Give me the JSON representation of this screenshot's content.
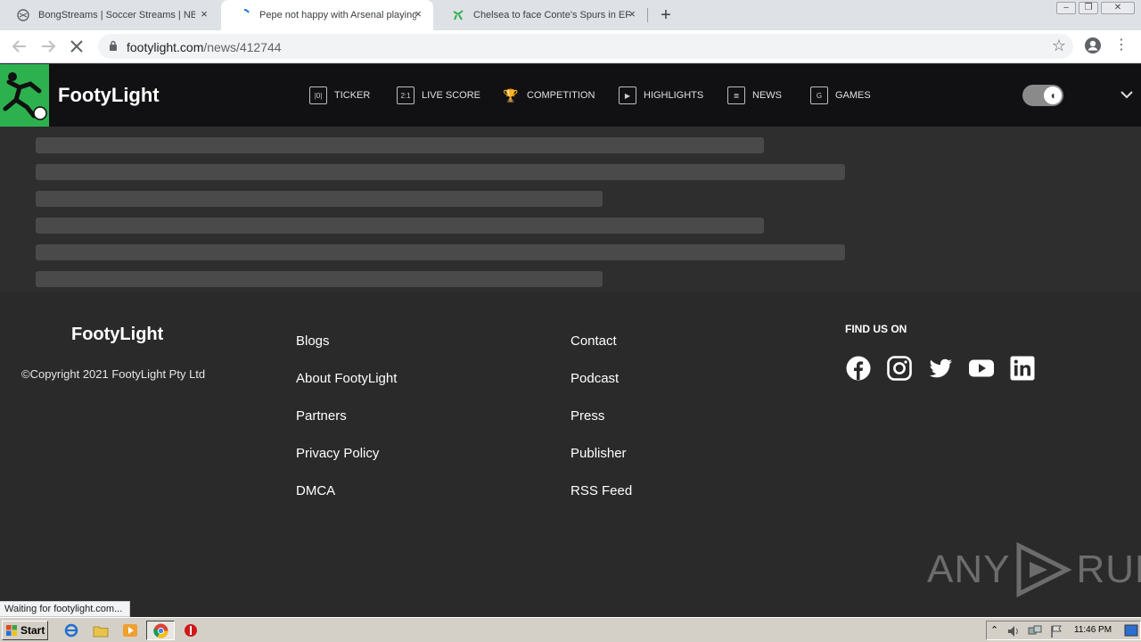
{
  "browser": {
    "tabs": [
      {
        "title": "BongStreams | Soccer Streams | NBA",
        "active": false,
        "close": "×"
      },
      {
        "title": "Pepe not happy with Arsenal playing",
        "active": true,
        "close": "×"
      },
      {
        "title": "Chelsea to face Conte's Spurs in EFL",
        "active": false,
        "close": "×"
      }
    ],
    "new_tab": "+",
    "window_buttons": [
      "–",
      "❐",
      "✕"
    ],
    "url_host": "footylight.com",
    "url_path": "/news/412744",
    "status_text": "Waiting for footylight.com..."
  },
  "site": {
    "brand": "FootyLight",
    "nav": [
      {
        "label": "TICKER",
        "icon": "ticker-icon",
        "glyph": "|0|"
      },
      {
        "label": "LIVE SCORE",
        "icon": "live-score-icon",
        "glyph": "2:1"
      },
      {
        "label": "COMPETITION",
        "icon": "trophy-icon",
        "glyph": "🏆"
      },
      {
        "label": "HIGHLIGHTS",
        "icon": "play-icon",
        "glyph": "▶"
      },
      {
        "label": "NEWS",
        "icon": "news-icon",
        "glyph": "≣"
      },
      {
        "label": "GAMES",
        "icon": "games-icon",
        "glyph": "G"
      }
    ],
    "theme_toggle_glyph": "◖",
    "dropdown_glyph": "⌄"
  },
  "footer": {
    "brand": "FootyLight",
    "copyright": "©Copyright 2021 FootyLight Pty Ltd",
    "links_col1": [
      "Blogs",
      "About FootyLight",
      "Partners",
      "Privacy Policy",
      "DMCA"
    ],
    "links_col2": [
      "Contact",
      "Podcast",
      "Press",
      "Publisher",
      "RSS Feed"
    ],
    "find_us": "FIND US ON",
    "social": [
      "facebook-icon",
      "instagram-icon",
      "twitter-icon",
      "youtube-icon",
      "linkedin-icon"
    ],
    "watermark_left": "ANY",
    "watermark_right": "RUN"
  },
  "taskbar": {
    "start": "Start",
    "clock": "11:46 PM"
  },
  "colors": {
    "brand_green": "#2db14f",
    "header_bg": "#111113",
    "footer_bg": "#2a2a2a"
  }
}
